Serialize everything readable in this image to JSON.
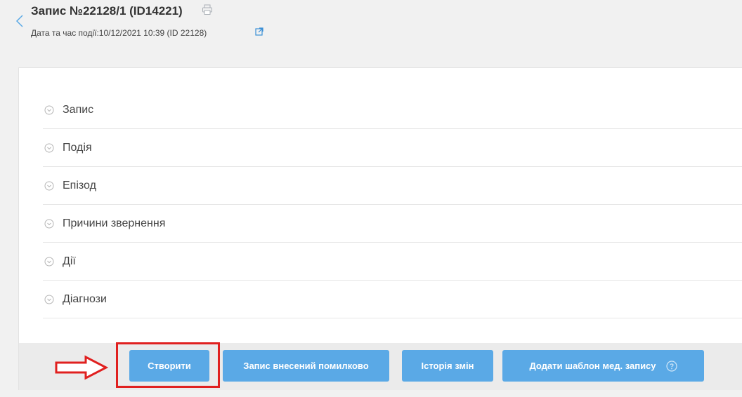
{
  "header": {
    "title": "Запис №22128/1 (ID14221)",
    "subtitle_label": "Дата та час події:",
    "subtitle_value": "10/12/2021 10:39 (ID 22128)"
  },
  "sections": [
    {
      "label": "Запис"
    },
    {
      "label": "Подія"
    },
    {
      "label": "Епізод"
    },
    {
      "label": "Причини звернення"
    },
    {
      "label": "Дії"
    },
    {
      "label": "Діагнози"
    }
  ],
  "footer": {
    "create_label": "Створити",
    "entered_in_error_label": "Запис внесений помилково",
    "history_label": "Історія змін",
    "add_template_label": "Додати шаблон мед. запису"
  },
  "colors": {
    "primary_button": "#5aa9e6",
    "highlight": "#e0201f"
  },
  "icons": [
    "back-chevron-icon",
    "print-icon",
    "external-link-icon",
    "chevron-down-circle-icon",
    "help-circle-icon",
    "arrow-right-icon"
  ]
}
